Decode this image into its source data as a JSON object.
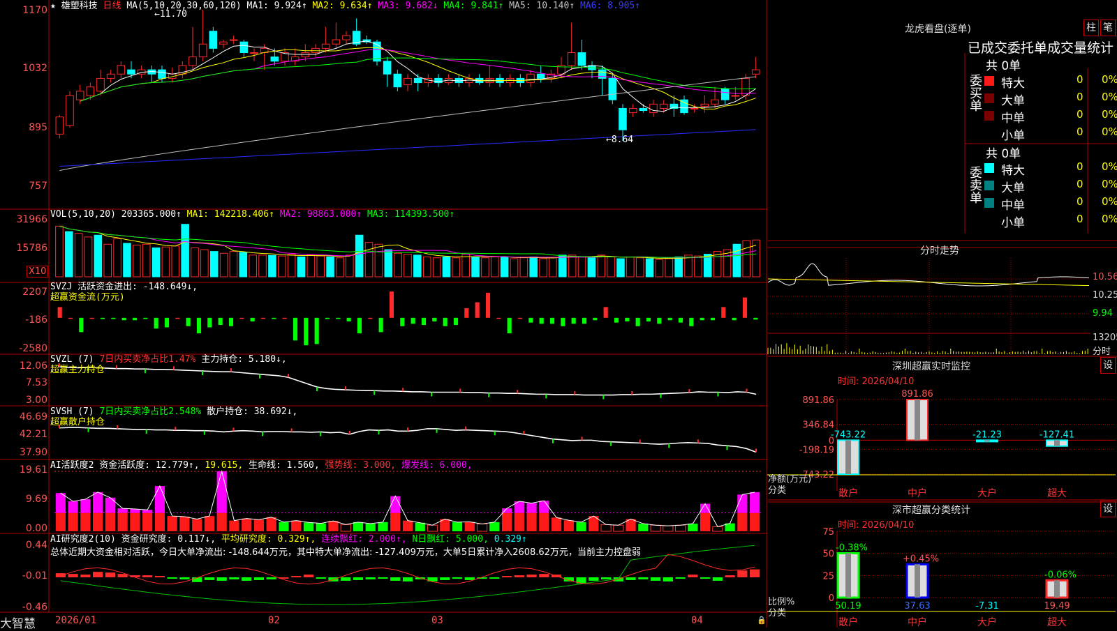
{
  "app": {
    "brand": "大智慧"
  },
  "colors": {
    "up": "#ff2a2a",
    "down": "#00ffff",
    "ma1": "#ffffff",
    "ma2": "#ffff00",
    "ma3": "#ff00ff",
    "ma4": "#00ff00",
    "ma5": "#c0c0c0",
    "ma6": "#2b2bff",
    "pos": "#ff2a2a",
    "neg": "#00ff00"
  },
  "price_header": {
    "star": "★",
    "name": "雄塑科技",
    "period": "日线",
    "ma_def": "MA(5,10,20,30,60,120)",
    "ma1": "MA1: 9.924↑",
    "ma2": "MA2: 9.634↑",
    "ma3": "MA3: 9.682↓",
    "ma4": "MA4: 9.841↑",
    "ma5": "MA5: 10.140↑",
    "ma6": "MA6: 8.905↑"
  },
  "price_axis": [
    "1170",
    "1032",
    "895",
    "757"
  ],
  "price_annotations": {
    "high": "11.70",
    "low": "8.64"
  },
  "vol_header": {
    "def": "VOL(5,10,20)",
    "val": "203365.000↑",
    "ma1": "MA1: 142218.406↑",
    "ma2": "MA2: 98863.000↑",
    "ma3": "MA3: 114393.500↑"
  },
  "vol_axis": [
    "31966",
    "15786"
  ],
  "vol_unit": "X10",
  "svzj": {
    "line1": "SVZJ  活跃资金进出: -148.649↓,",
    "line2": "超赢资金流(万元)",
    "axis": [
      "2207",
      "-186",
      "-2580"
    ]
  },
  "svzl": {
    "code": "SVZL (7)",
    "ratio": "7日内买卖净占比1.47%",
    "hold": "主力持仓: 5.180↓,",
    "line2": "超赢主力持仓",
    "axis": [
      "12.06",
      "7.53",
      "3.00"
    ]
  },
  "svsh": {
    "code": "SVSH (7)",
    "ratio": "7日内买卖净占比2.548%",
    "hold": "散户持仓: 38.692↓,",
    "line2": "超赢散户持仓",
    "axis": [
      "46.69",
      "42.21",
      "37.90"
    ]
  },
  "ai_act": {
    "p1": "AI活跃度2 资金活跃度: 12.779↑,",
    "p2": "19.615,",
    "p3": "生命线: 1.560,",
    "p4": "强势线: 3.000,",
    "p5": "爆发线: 6.000,",
    "axis": [
      "19.61",
      "9.69",
      "0.00"
    ]
  },
  "ai_res": {
    "p1": "AI研究度2(10) 资金研究度: 0.117↓,",
    "p2": "平均研究度: 0.329↑,",
    "p3": "连续飘红: 2.000↑,",
    "p4": "N日飘红: 5.000,",
    "p5": "0.329↑",
    "summary": "总体近期大资金相对活跃，今日大单净流出: -148.644万元，其中特大单净流出: -127.409万元，大单5日累计净入2608.62万元，当前主力控盘弱",
    "axis": [
      "0.44",
      "-0.01",
      "-0.46"
    ]
  },
  "date_axis": [
    "2026/01",
    "02",
    "03",
    "04"
  ],
  "dragon": {
    "title": "龙虎看盘(逐单)",
    "btn1": "柱",
    "btn2": "笔",
    "tabs": "已成交委托单成交量统计",
    "buy": {
      "side": "委买单",
      "total": "共 0单",
      "rows": [
        {
          "label": "特大",
          "count": "0",
          "pct": "0%"
        },
        {
          "label": "大单",
          "count": "0",
          "pct": "0%"
        },
        {
          "label": "中单",
          "count": "0",
          "pct": "0%"
        },
        {
          "label": "小单",
          "count": "0",
          "pct": "0%"
        }
      ]
    },
    "sell": {
      "side": "委卖单",
      "total": "共 0单",
      "rows": [
        {
          "label": "特大",
          "count": "0",
          "pct": "0%"
        },
        {
          "label": "大单",
          "count": "0",
          "pct": "0%"
        },
        {
          "label": "中单",
          "count": "0",
          "pct": "0%"
        },
        {
          "label": "小单",
          "count": "0",
          "pct": "0%"
        }
      ]
    }
  },
  "intraday": {
    "title": "分时走势",
    "axis": [
      "10.56",
      "10.25",
      "9.94"
    ],
    "vol": "13205",
    "vol_label": "分时"
  },
  "monitor": {
    "title": "深圳超赢实时监控",
    "btn": "设",
    "time": "时间: 2026/04/10",
    "ylabels": [
      "891.86",
      "346.84",
      "0",
      "-198.19",
      "-743.22"
    ],
    "ytitle": "净额(万元)",
    "xtitle": "分类",
    "categories": [
      "散户",
      "中户",
      "大户",
      "超大"
    ],
    "values": [
      -743.22,
      891.86,
      -21.23,
      -127.41
    ],
    "labels": [
      "-743.22",
      "891.86",
      "-21.23",
      "-127.41"
    ]
  },
  "classify": {
    "title": "深市超赢分类统计",
    "btn": "设",
    "time": "时间: 2026/04/10",
    "ylabels": [
      "75",
      "50",
      "25",
      "0"
    ],
    "ytitle": "比例%",
    "xtitle": "分类",
    "categories": [
      "散户",
      "中户",
      "大户",
      "超大"
    ],
    "values": [
      50.19,
      37.63,
      -7.31,
      19.49
    ],
    "top_labels": [
      "-0.38%",
      "+0.45%",
      "",
      "-0.06%"
    ],
    "bottom_labels": [
      "50.19",
      "37.63",
      "-7.31",
      "19.49"
    ]
  },
  "chart_data": [
    {
      "type": "candlestick",
      "title": "雄塑科技 日线",
      "x": [
        "2026/01",
        "02",
        "03",
        "04"
      ],
      "ylim": [
        7.57,
        11.7
      ],
      "candles": [
        [
          8.8,
          9.2,
          8.7,
          9.25
        ],
        [
          9.0,
          9.7,
          8.95,
          9.8
        ],
        [
          9.6,
          9.8,
          9.5,
          9.95
        ],
        [
          9.7,
          9.9,
          9.6,
          10.0
        ],
        [
          9.8,
          10.1,
          9.7,
          10.3
        ],
        [
          10.1,
          10.2,
          10.0,
          10.3
        ],
        [
          10.2,
          10.4,
          10.1,
          10.5
        ],
        [
          10.3,
          10.2,
          10.1,
          10.5
        ],
        [
          10.2,
          10.3,
          10.1,
          10.4
        ],
        [
          10.3,
          10.2,
          10.0,
          10.4
        ],
        [
          10.3,
          10.1,
          10.0,
          10.4
        ],
        [
          10.1,
          10.2,
          10.0,
          10.35
        ],
        [
          10.2,
          10.4,
          10.1,
          10.5
        ],
        [
          10.4,
          10.6,
          10.3,
          11.3
        ],
        [
          10.6,
          10.9,
          10.5,
          11.7
        ],
        [
          11.2,
          10.8,
          10.7,
          11.3
        ],
        [
          10.9,
          10.95,
          10.8,
          11.0
        ],
        [
          11.0,
          11.0,
          10.9,
          11.1
        ],
        [
          10.95,
          10.7,
          10.6,
          11.0
        ],
        [
          10.7,
          10.7,
          10.5,
          10.8
        ],
        [
          10.7,
          10.8,
          10.3,
          10.9
        ],
        [
          10.6,
          10.5,
          10.4,
          10.8
        ],
        [
          10.5,
          10.7,
          10.4,
          10.8
        ],
        [
          10.5,
          10.6,
          10.4,
          10.8
        ],
        [
          10.6,
          10.7,
          10.5,
          10.9
        ],
        [
          10.7,
          10.8,
          10.6,
          10.9
        ],
        [
          10.8,
          10.9,
          10.7,
          11.3
        ],
        [
          10.9,
          11.0,
          10.8,
          11.4
        ],
        [
          11.0,
          11.1,
          10.9,
          11.2
        ],
        [
          11.2,
          10.9,
          10.85,
          11.5
        ],
        [
          11.0,
          10.95,
          10.9,
          11.1
        ],
        [
          10.95,
          10.5,
          10.4,
          11.0
        ],
        [
          10.5,
          10.2,
          9.9,
          10.6
        ],
        [
          10.2,
          9.9,
          9.8,
          10.3
        ],
        [
          9.95,
          10.1,
          9.8,
          10.2
        ],
        [
          10.1,
          10.0,
          9.8,
          10.2
        ],
        [
          10.0,
          10.1,
          9.9,
          10.2
        ],
        [
          10.1,
          10.0,
          9.9,
          10.2
        ],
        [
          10.0,
          10.1,
          9.95,
          10.2
        ],
        [
          10.1,
          10.0,
          9.9,
          10.2
        ],
        [
          10.0,
          10.1,
          9.9,
          10.2
        ],
        [
          10.1,
          10.0,
          9.95,
          10.2
        ],
        [
          10.0,
          10.1,
          9.9,
          10.4
        ],
        [
          10.1,
          10.0,
          9.9,
          10.2
        ],
        [
          10.0,
          10.1,
          9.9,
          10.2
        ],
        [
          10.1,
          10.0,
          9.9,
          10.2
        ],
        [
          10.0,
          10.2,
          9.9,
          10.3
        ],
        [
          10.2,
          10.1,
          10.0,
          10.4
        ],
        [
          10.1,
          10.2,
          10.0,
          10.3
        ],
        [
          10.2,
          10.4,
          10.1,
          10.6
        ],
        [
          10.4,
          10.7,
          10.3,
          11.4
        ],
        [
          10.7,
          10.4,
          10.3,
          11.0
        ],
        [
          10.4,
          10.3,
          10.1,
          10.5
        ],
        [
          10.3,
          10.1,
          9.7,
          10.4
        ],
        [
          10.1,
          9.6,
          9.5,
          10.2
        ],
        [
          9.4,
          8.9,
          8.64,
          9.5
        ],
        [
          9.3,
          9.4,
          9.2,
          9.5
        ],
        [
          9.4,
          9.35,
          9.3,
          9.5
        ],
        [
          9.3,
          9.5,
          9.2,
          9.6
        ],
        [
          9.4,
          9.5,
          9.3,
          9.6
        ],
        [
          9.5,
          9.4,
          9.2,
          9.7
        ],
        [
          9.6,
          9.3,
          9.25,
          9.7
        ],
        [
          9.4,
          9.4,
          9.3,
          9.5
        ],
        [
          9.45,
          9.5,
          9.3,
          9.7
        ],
        [
          9.5,
          9.6,
          9.4,
          9.9
        ],
        [
          9.85,
          9.6,
          9.5,
          9.9
        ],
        [
          9.7,
          9.7,
          9.6,
          9.9
        ],
        [
          9.7,
          10.1,
          9.6,
          10.2
        ],
        [
          10.2,
          10.3,
          10.1,
          10.6
        ]
      ]
    },
    {
      "type": "bar",
      "title": "VOL(5,10,20)",
      "unit": "X10",
      "ylim": [
        0,
        31966
      ],
      "values": [
        28000,
        25000,
        24000,
        22000,
        23000,
        18000,
        21000,
        18500,
        17500,
        18000,
        16000,
        16500,
        17000,
        29000,
        16000,
        15000,
        14000,
        13000,
        14000,
        13500,
        12000,
        12000,
        11800,
        11500,
        12500,
        11000,
        12000,
        11500,
        11000,
        10500,
        12000,
        23000,
        19000,
        18000,
        15000,
        13000,
        12500,
        12000,
        11000,
        10500,
        11000,
        10500,
        12500,
        11000,
        10500,
        11000,
        11000,
        10000,
        10500,
        11000,
        10000,
        10500,
        12000,
        12000,
        11000,
        10500,
        12000,
        11000,
        10000,
        11000,
        10500,
        10000,
        9500,
        10000,
        11000,
        12000,
        11500,
        12500,
        14000,
        15000,
        18000,
        20000,
        20336.5
      ]
    },
    {
      "type": "bar",
      "title": "SVZJ 超赢资金流(万元)",
      "ylim": [
        -2580,
        2207
      ],
      "values": [
        900,
        0,
        -1200,
        0,
        -100,
        -100,
        -200,
        -200,
        -100,
        -900,
        -800,
        0,
        -700,
        -1300,
        -800,
        -600,
        -700,
        0,
        -300,
        0,
        -100,
        0,
        -1900,
        -2300,
        -2200,
        -100,
        -100,
        -300,
        -1300,
        0,
        -1200,
        2200,
        -700,
        -500,
        -600,
        -300,
        -700,
        -600,
        800,
        1300,
        2100,
        0,
        -1300,
        0,
        -400,
        -500,
        -500,
        -700,
        -500,
        -500,
        -200,
        900,
        -400,
        -300,
        -700,
        -300,
        -500,
        -200,
        -400,
        -700,
        -200,
        -200,
        900,
        -200,
        1700,
        -148.649
      ]
    },
    {
      "type": "line",
      "title": "SVZL 超赢主力持仓",
      "ylim": [
        3.0,
        12.06
      ],
      "values": [
        12.06,
        11.9,
        11.8,
        11.9,
        11.8,
        11.7,
        11.6,
        11.6,
        11.5,
        11.5,
        11.4,
        11.4,
        11.3,
        11.2,
        11.1,
        11.0,
        10.9,
        10.8,
        10.8,
        10.6,
        10.4,
        10.2,
        10.0,
        9.8,
        9.4,
        8.6,
        7.8,
        7.0,
        6.6,
        6.4,
        6.3,
        6.2,
        6.1,
        6.1,
        6.0,
        6.0,
        5.9,
        5.8,
        5.8,
        5.7,
        5.7,
        5.7,
        5.7,
        5.6,
        5.6,
        5.5,
        5.5,
        5.4,
        5.4,
        5.3,
        5.2,
        5.2,
        5.1,
        5.1,
        5.1,
        5.0,
        5.0,
        5.0,
        5.0,
        5.1,
        5.1,
        5.2,
        5.2,
        5.3,
        5.4,
        5.5,
        5.6,
        5.8,
        5.7,
        5.7,
        5.6,
        5.8,
        5.7,
        5.18
      ]
    },
    {
      "type": "line",
      "title": "SVSH 超赢散户持仓",
      "ylim": [
        37.9,
        46.69
      ],
      "values": [
        44.8,
        44.9,
        44.9,
        44.8,
        44.7,
        44.7,
        44.6,
        44.5,
        44.4,
        44.4,
        44.3,
        44.3,
        44.2,
        44.2,
        44.1,
        44.1,
        44.0,
        43.8,
        44.0,
        44.1,
        44.0,
        43.8,
        43.9,
        43.9,
        43.8,
        43.8,
        43.7,
        43.8,
        43.6,
        43.7,
        43.2,
        43.9,
        44.3,
        44.2,
        44.3,
        44.0,
        44.0,
        44.2,
        44.6,
        44.6,
        44.4,
        44.2,
        44.3,
        44.2,
        44.1,
        44.0,
        43.9,
        43.6,
        43.2,
        42.8,
        42.4,
        42.0,
        41.8,
        41.6,
        41.7,
        41.7,
        41.4,
        41.3,
        41.2,
        41.1,
        41.0,
        40.8,
        40.7,
        40.8,
        41.0,
        41.1,
        41.0,
        40.9,
        40.5,
        40.3,
        40.1,
        39.6,
        38.692
      ]
    },
    {
      "type": "bar",
      "title": "AI活跃度2",
      "ylim": [
        0,
        19.61
      ],
      "values": [
        12.5,
        9.8,
        10.5,
        12.8,
        11.0,
        7.5,
        7.3,
        7.0,
        14.8,
        5.0,
        4.8,
        4.0,
        5.0,
        19.61,
        3.5,
        4.2,
        3.8,
        4.6,
        3.0,
        3.5,
        2.9,
        2.6,
        3.4,
        2.2,
        3.0,
        2.5,
        3.0,
        11.5,
        3.5,
        2.8,
        2.0,
        4.0,
        3.0,
        3.1,
        2.4,
        3.0,
        7.5,
        9.8,
        9.2,
        10.0,
        4.5,
        3.6,
        3.0,
        5.0,
        2.2,
        2.0,
        4.0,
        2.5,
        2.0,
        1.8,
        2.0,
        2.5,
        9.0,
        1.5,
        2.6,
        12.0,
        12.779
      ]
    },
    {
      "type": "bar",
      "title": "AI研究度2(10)",
      "ylim": [
        -0.46,
        0.44
      ],
      "values": [
        0.06,
        0.05,
        0.04,
        0.08,
        0.07,
        0.05,
        0.03,
        0.03,
        0.02,
        -0.02,
        -0.03,
        -0.07,
        -0.04,
        -0.05,
        -0.03,
        -0.05,
        -0.04,
        -0.03,
        0.0,
        0.02,
        0.04,
        -0.02,
        -0.06,
        -0.05,
        -0.04,
        -0.03,
        -0.02,
        -0.05,
        -0.06,
        -0.03,
        -0.06,
        -0.04,
        -0.02,
        -0.04,
        -0.02,
        -0.01,
        0.02,
        0.03,
        0.04,
        0.05,
        0.04,
        -0.06,
        -0.09,
        -0.05,
        -0.03,
        -0.06,
        -0.04,
        -0.03,
        -0.05,
        -0.06,
        -0.02,
        0.04,
        -0.02,
        -0.05,
        0.03,
        0.1,
        0.117
      ]
    },
    {
      "type": "bar",
      "title": "深圳超赢实时监控",
      "categories": [
        "散户",
        "中户",
        "大户",
        "超大"
      ],
      "values": [
        -743.22,
        891.86,
        -21.23,
        -127.41
      ],
      "ylabel": "净额(万元)",
      "xlabel": "分类"
    },
    {
      "type": "bar",
      "title": "深市超赢分类统计",
      "categories": [
        "散户",
        "中户",
        "大户",
        "超大"
      ],
      "values": [
        50.19,
        37.63,
        -7.31,
        19.49
      ],
      "ylabel": "比例%",
      "xlabel": "分类",
      "ylim": [
        0,
        75
      ]
    }
  ]
}
